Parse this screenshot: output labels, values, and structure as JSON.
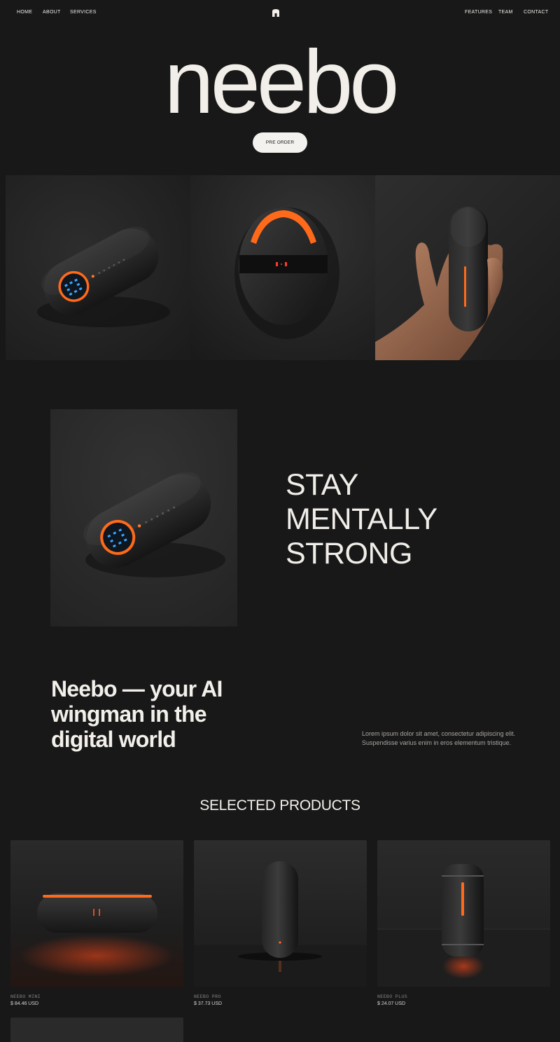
{
  "nav": {
    "left": [
      "HOME",
      "ABOUT",
      "SERVICES"
    ],
    "right": [
      "FEATURES",
      "TEAM",
      "CONTACT"
    ],
    "logo_icon": "arch-logo-icon"
  },
  "hero": {
    "brand": "neebo",
    "cta": "PRE ORDER"
  },
  "feature": {
    "headline_lines": [
      "STAY",
      "MENTALLY",
      "STRONG"
    ]
  },
  "intro": {
    "heading": "Neebo — your AI wingman in the digital world",
    "body": "Lorem ipsum dolor sit amet, consectetur adipiscing elit. Suspendisse varius enim in eros elementum tristique."
  },
  "products": {
    "title": "SELECTED PRODUCTS",
    "items": [
      {
        "name": "NEEBO MINI",
        "price": "$ 84.46 USD"
      },
      {
        "name": "NEEBO PRO",
        "price": "$ 37.73 USD"
      },
      {
        "name": "NEEBO PLUS",
        "price": "$ 24.07 USD"
      }
    ]
  },
  "colors": {
    "background": "#181818",
    "accent_orange": "#ff6a1a",
    "accent_blue": "#3aa6ff",
    "text": "#f2efea"
  }
}
